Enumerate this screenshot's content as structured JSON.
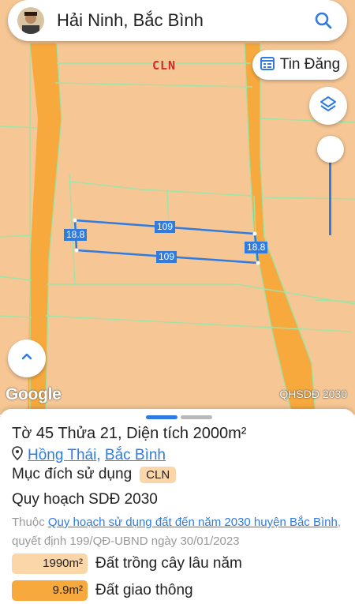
{
  "search": {
    "query": "Hải Ninh, Bắc Bình"
  },
  "map": {
    "zone_label": "CLN",
    "news_button_label": "Tin Đăng",
    "dimensions": {
      "top": "109",
      "bottom": "109",
      "left": "18.8",
      "right": "18.8"
    },
    "attribution": "QHSDĐ 2030",
    "google_logo": "Google",
    "colors": {
      "land": "#f6c795",
      "road": "#f7a93d",
      "parcel_border": "#9fe3a8",
      "selection": "#2f7be0"
    }
  },
  "info": {
    "title": "Tờ 45 Thửa 21, Diện tích 2000m²",
    "location_1": "Hồng Thái",
    "location_sep": ",",
    "location_2": "Bắc Bình",
    "purpose_label": "Mục đích sử dụng",
    "purpose_code": "CLN",
    "plan_label": "Quy hoạch SDĐ 2030",
    "desc_prefix": "Thuộc ",
    "desc_link": "Quy hoạch sử dụng đất đến năm 2030 huyện Bắc Bình",
    "desc_suffix": ", quyết định 199/QĐ-UBND ngày 30/01/2023",
    "legend": [
      {
        "value": "1990m²",
        "label": "Đất trồng cây lâu năm",
        "color": "#fad6a8"
      },
      {
        "value": "9.9m²",
        "label": "Đất giao thông",
        "color": "#f7a93d"
      }
    ]
  },
  "icons": {
    "search": "search-icon",
    "location": "location-pin-icon",
    "news": "calendar-list-icon",
    "layers": "layers-icon",
    "up": "chevron-up-icon"
  }
}
